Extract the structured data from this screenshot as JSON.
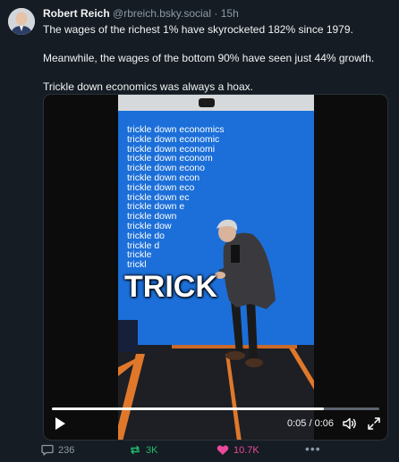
{
  "post": {
    "author_name": "Robert Reich",
    "handle": "@rbreich.bsky.social",
    "separator": "·",
    "time_ago": "15h",
    "paragraphs": [
      "The wages of the richest 1% have skyrocketed 182% since 1979.",
      "Meanwhile, the wages of the bottom 90% have seen just 44% growth.",
      "Trickle down economics was always a hoax."
    ]
  },
  "video": {
    "overlay_lines": [
      "trickle down economics",
      "trickle down economic",
      "trickle down economi",
      "trickle down econom",
      "trickle down econo",
      "trickle down econ",
      "trickle down eco",
      "trickle down ec",
      "trickle down e",
      "trickle down",
      "trickle dow",
      "trickle do",
      "trickle d",
      "trickle",
      "trickl"
    ],
    "big_word": "TRICK",
    "time_display": "0:05 / 0:06",
    "progress_fraction": 0.83
  },
  "actions": {
    "replies": "236",
    "reposts": "3K",
    "likes": "10.7K",
    "more": "•••"
  },
  "colors": {
    "background": "#151c23",
    "repost": "#20bc6b",
    "like": "#ec4899",
    "muted": "#8d99a6"
  }
}
